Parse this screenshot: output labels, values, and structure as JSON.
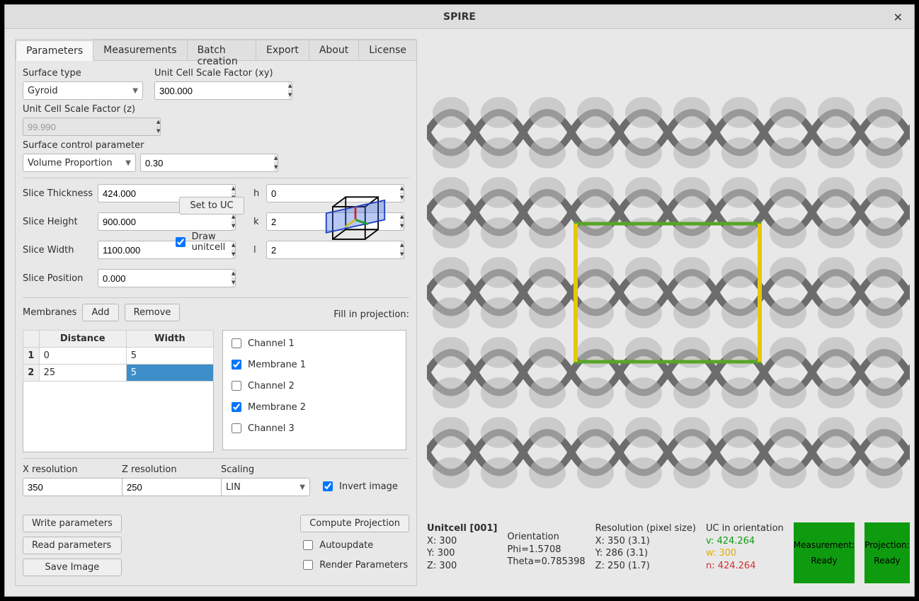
{
  "window": {
    "title": "SPIRE"
  },
  "tabs": [
    "Parameters",
    "Measurements",
    "Batch creation",
    "Export",
    "About",
    "License"
  ],
  "surface": {
    "type_label": "Surface type",
    "type_value": "Gyroid",
    "ucxy_label": "Unit Cell Scale Factor (xy)",
    "ucxy_value": "300.000",
    "ucz_label": "Unit Cell Scale Factor  (z)",
    "ucz_value": "99.990",
    "ctrl_label": "Surface control parameter",
    "ctrl_value": "Volume Proportion",
    "ctrl_num": "0.30"
  },
  "slice": {
    "thickness_label": "Slice Thickness",
    "thickness": "424.000",
    "height_label": "Slice Height",
    "height": "900.000",
    "width_label": "Slice Width",
    "width": "1100.000",
    "position_label": "Slice Position",
    "position": "0.000",
    "set_to_uc": "Set to UC",
    "draw_unitcell_label": "Draw unitcell",
    "hkl": {
      "h_label": "h",
      "h": "0",
      "k_label": "k",
      "k": "2",
      "l_label": "l",
      "l": "2"
    }
  },
  "membranes": {
    "label": "Membranes",
    "add": "Add",
    "remove": "Remove",
    "fill_label": "Fill in projection:",
    "headers": [
      "Distance",
      "Width"
    ],
    "rows": [
      {
        "idx": "1",
        "distance": "0",
        "width": "5",
        "sel": false
      },
      {
        "idx": "2",
        "distance": "25",
        "width": "5",
        "sel": true
      }
    ],
    "channels": [
      {
        "label": "Channel 1",
        "checked": false
      },
      {
        "label": "Membrane 1",
        "checked": true
      },
      {
        "label": "Channel 2",
        "checked": false
      },
      {
        "label": "Membrane 2",
        "checked": true
      },
      {
        "label": "Channel 3",
        "checked": false
      }
    ]
  },
  "resolution": {
    "x_label": "X resolution",
    "x": "350",
    "z_label": "Z resolution",
    "z": "250",
    "scaling_label": "Scaling",
    "scaling": "LIN",
    "invert_label": "Invert image"
  },
  "actions": {
    "write": "Write parameters",
    "read": "Read parameters",
    "save_image": "Save Image",
    "compute": "Compute Projection",
    "autoupdate": "Autoupdate",
    "render_params": "Render Parameters"
  },
  "status": {
    "unitcell_title": "Unitcell [001]",
    "uc_x": "X: 300",
    "uc_y": "Y: 300",
    "uc_z": "Z: 300",
    "orient_title": "Orientation",
    "phi": "Phi=1.5708",
    "theta": "Theta=0.785398",
    "res_title": "Resolution (pixel size)",
    "res_x": "X:   350 (3.1)",
    "res_y": "Y:   286 (3.1)",
    "res_z": "Z:   250 (1.7)",
    "uc_orient_title": "UC in orientation",
    "v": "v: 424.264",
    "w": "w: 300",
    "n": "n: 424.264",
    "badge1_top": "Measurement:",
    "badge1_bot": "Ready",
    "badge2_top": "Projection:",
    "badge2_bot": "Ready"
  }
}
